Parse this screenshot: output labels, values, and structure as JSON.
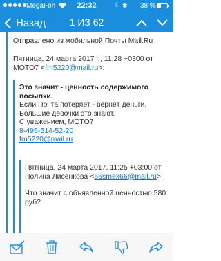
{
  "status_bar": {
    "carrier": "MegaFon",
    "time": "22:32",
    "battery_text": "38 %",
    "battery_level": 0.38
  },
  "nav": {
    "back_label": "Назад",
    "counter": "1 ИЗ 62"
  },
  "message": {
    "sent_from": "Отправлено из мобильной Почты Mail.Ru",
    "quote1_header_line1": "Пятница, 24 марта 2017 г., 11:28 +0300 от",
    "quote1_sender_name": "MOTO7 ",
    "quote1_sender_email": "fm5220@mail.ru",
    "question_line1": "Это значит - ценность содержимого",
    "question_line2": "посылки.",
    "answer_line1": "Если Почта  потеряет - вернёт деньги.",
    "answer_line2": "Большие девочки это знают.",
    "regards": "С уважением, MOTO7",
    "phone": "8-495-514-52-20",
    "signature_email": "fm5220@mail.ru",
    "quote2_header_line1": "Пятница, 24 марта 2017, 11:25 +03:00 от",
    "quote2_sender_name": "Полина Лисенкова ",
    "quote2_sender_email": "66smex66@mail.ru",
    "original_question_line1": "Что значит с объявленной ценностью 580",
    "original_question_line2": "руб?"
  },
  "colors": {
    "header": "#1a8ddc",
    "accent": "#1a8ddc",
    "link": "#1573c7",
    "toolbar_bg": "#f7f7f7"
  },
  "toolbar": {
    "icons": [
      "compose-mail-icon",
      "trash-icon",
      "reply-icon",
      "dislike-icon",
      "forward-icon"
    ]
  }
}
